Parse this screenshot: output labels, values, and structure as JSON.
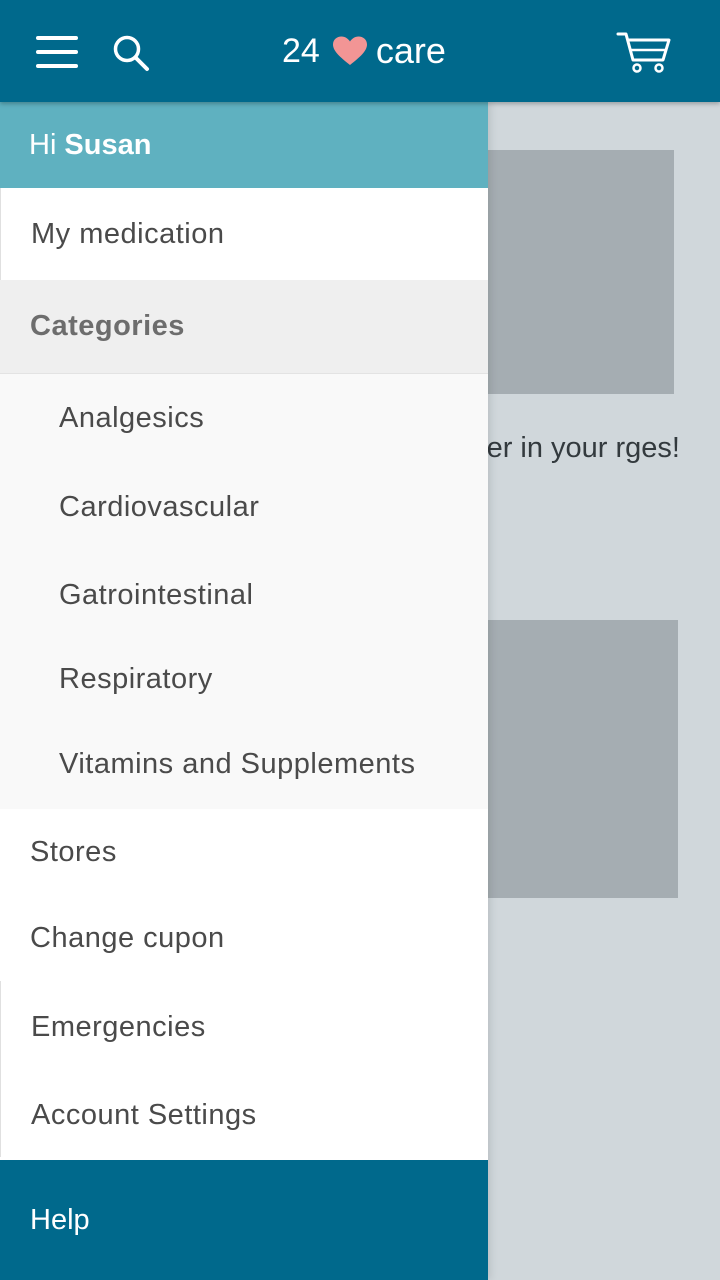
{
  "header": {
    "logo_number": "24",
    "logo_word": "care",
    "icons": [
      "menu-icon",
      "search-icon",
      "heart-icon",
      "cart-icon"
    ],
    "accent_color": "#00698c",
    "heart_color": "#f29595"
  },
  "drawer": {
    "greeting_prefix": "Hi",
    "user_name": "Susan",
    "my_medication": "My medication",
    "categories_label": "Categories",
    "categories": [
      "Analgesics",
      "Cardiovascular",
      "Gatrointestinal",
      "Respiratory",
      "Vitamins and Supplements"
    ],
    "stores": "Stores",
    "change_coupon": "Change cupon",
    "emergencies": "Emergencies",
    "account_settings": "Account Settings",
    "help": "Help",
    "greeting_color": "#5fb1c0"
  },
  "background": {
    "text": "liver in your rges!"
  }
}
